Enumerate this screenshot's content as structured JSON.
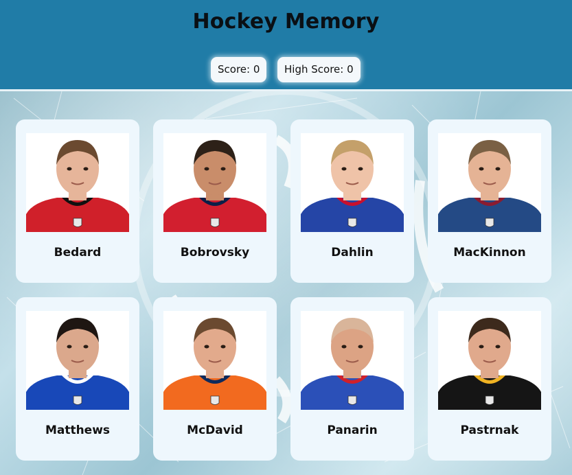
{
  "header": {
    "title": "Hockey Memory",
    "score_label": "Score: 0",
    "high_score_label": "High Score: 0"
  },
  "cards": [
    {
      "name": "Bedard",
      "jersey": "#d0202a",
      "trim": "#101010",
      "skin": "#e6b59a",
      "hair": "#6b4a30"
    },
    {
      "name": "Bobrovsky",
      "jersey": "#d21f2f",
      "trim": "#0b1f48",
      "skin": "#c98d6a",
      "hair": "#2d2118"
    },
    {
      "name": "Dahlin",
      "jersey": "#2545a6",
      "trim": "#c8102e",
      "skin": "#efc3a8",
      "hair": "#c4a06a"
    },
    {
      "name": "MacKinnon",
      "jersey": "#244a85",
      "trim": "#8b1c30",
      "skin": "#e5b395",
      "hair": "#7a6044"
    },
    {
      "name": "Matthews",
      "jersey": "#1848b8",
      "trim": "#ffffff",
      "skin": "#dba88c",
      "hair": "#1e1612"
    },
    {
      "name": "McDavid",
      "jersey": "#f26a1f",
      "trim": "#0e2a5c",
      "skin": "#e2aa8c",
      "hair": "#6b4a30"
    },
    {
      "name": "Panarin",
      "jersey": "#2b50b8",
      "trim": "#d0202a",
      "skin": "#dca384",
      "hair": "#d9b59a"
    },
    {
      "name": "Pastrnak",
      "jersey": "#151515",
      "trim": "#f0b323",
      "skin": "#e0a98c",
      "hair": "#3d2a1c"
    }
  ]
}
